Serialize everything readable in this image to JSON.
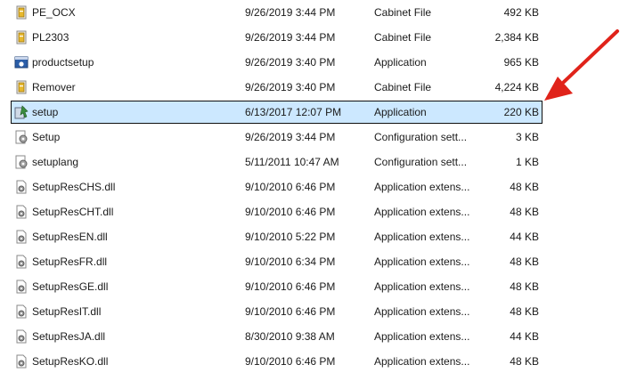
{
  "colors": {
    "selection_bg": "#cce8ff",
    "selection_border": "#0f0f0f",
    "arrow": "#e0231a"
  },
  "rows": [
    {
      "name": "PE_OCX",
      "date": "9/26/2019 3:44 PM",
      "type": "Cabinet File",
      "size": "492 KB",
      "icon": "cabinet-file-icon"
    },
    {
      "name": "PL2303",
      "date": "9/26/2019 3:44 PM",
      "type": "Cabinet File",
      "size": "2,384 KB",
      "icon": "cabinet-file-icon"
    },
    {
      "name": "productsetup",
      "date": "9/26/2019 3:40 PM",
      "type": "Application",
      "size": "965 KB",
      "icon": "application-icon"
    },
    {
      "name": "Remover",
      "date": "9/26/2019 3:40 PM",
      "type": "Cabinet File",
      "size": "4,224 KB",
      "icon": "cabinet-file-icon"
    },
    {
      "name": "setup",
      "date": "6/13/2017 12:07 PM",
      "type": "Application",
      "size": "220 KB",
      "icon": "setup-application-icon",
      "selected": true
    },
    {
      "name": "Setup",
      "date": "9/26/2019 3:44 PM",
      "type": "Configuration sett...",
      "size": "3 KB",
      "icon": "configuration-settings-icon"
    },
    {
      "name": "setuplang",
      "date": "5/11/2011 10:47 AM",
      "type": "Configuration sett...",
      "size": "1 KB",
      "icon": "configuration-settings-icon"
    },
    {
      "name": "SetupResCHS.dll",
      "date": "9/10/2010 6:46 PM",
      "type": "Application extens...",
      "size": "48 KB",
      "icon": "dll-file-icon"
    },
    {
      "name": "SetupResCHT.dll",
      "date": "9/10/2010 6:46 PM",
      "type": "Application extens...",
      "size": "48 KB",
      "icon": "dll-file-icon"
    },
    {
      "name": "SetupResEN.dll",
      "date": "9/10/2010 5:22 PM",
      "type": "Application extens...",
      "size": "44 KB",
      "icon": "dll-file-icon"
    },
    {
      "name": "SetupResFR.dll",
      "date": "9/10/2010 6:34 PM",
      "type": "Application extens...",
      "size": "48 KB",
      "icon": "dll-file-icon"
    },
    {
      "name": "SetupResGE.dll",
      "date": "9/10/2010 6:46 PM",
      "type": "Application extens...",
      "size": "48 KB",
      "icon": "dll-file-icon"
    },
    {
      "name": "SetupResIT.dll",
      "date": "9/10/2010 6:46 PM",
      "type": "Application extens...",
      "size": "48 KB",
      "icon": "dll-file-icon"
    },
    {
      "name": "SetupResJA.dll",
      "date": "8/30/2010 9:38 AM",
      "type": "Application extens...",
      "size": "44 KB",
      "icon": "dll-file-icon"
    },
    {
      "name": "SetupResKO.dll",
      "date": "9/10/2010 6:46 PM",
      "type": "Application extens...",
      "size": "48 KB",
      "icon": "dll-file-icon"
    }
  ]
}
